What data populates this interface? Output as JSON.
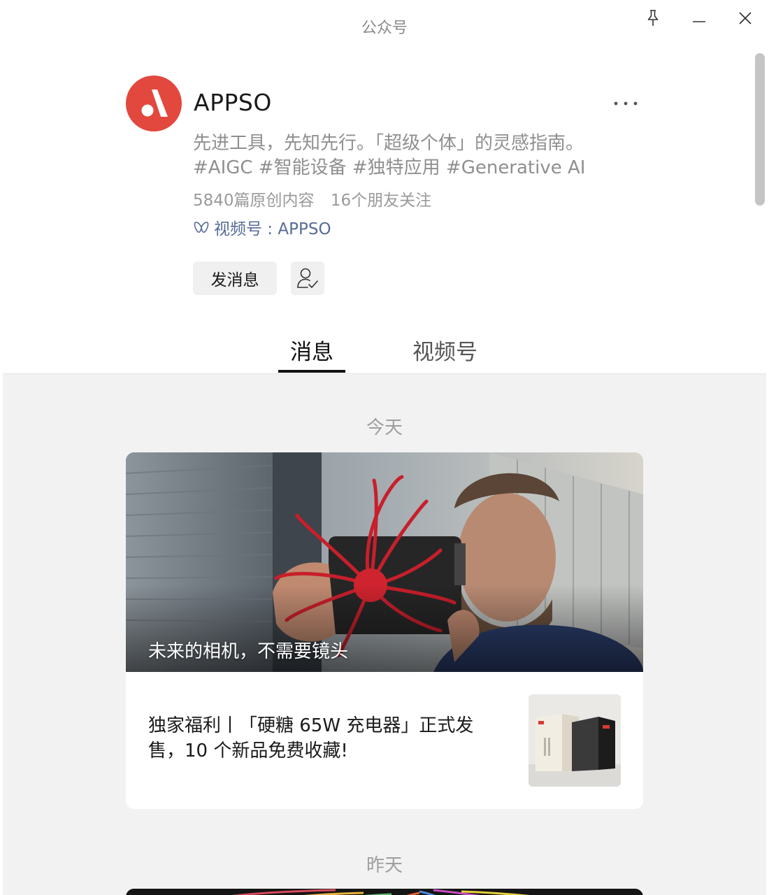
{
  "window": {
    "title": "公众号"
  },
  "profile": {
    "name": "APPSO",
    "description": "先进工具，先知先行。「超级个体」的灵感指南。 #AIGC #智能设备 #独特应用 #Generative AI",
    "original_count": "5840篇原创内容",
    "friends_following": "16个朋友关注",
    "channel_label": "视频号 : APPSO",
    "send_message_label": "发消息",
    "brand_color": "#e2483d",
    "link_color": "#576b95"
  },
  "tabs": {
    "messages": "消息",
    "channels": "视频号"
  },
  "feed": {
    "groups": [
      {
        "date": "今天",
        "main_article": {
          "title": "未来的相机，不需要镜头"
        },
        "sub_article": {
          "title": "独家福利丨「硬糖 65W 充电器」正式发售，10 个新品免费收藏!"
        }
      },
      {
        "date": "昨天"
      }
    ]
  }
}
